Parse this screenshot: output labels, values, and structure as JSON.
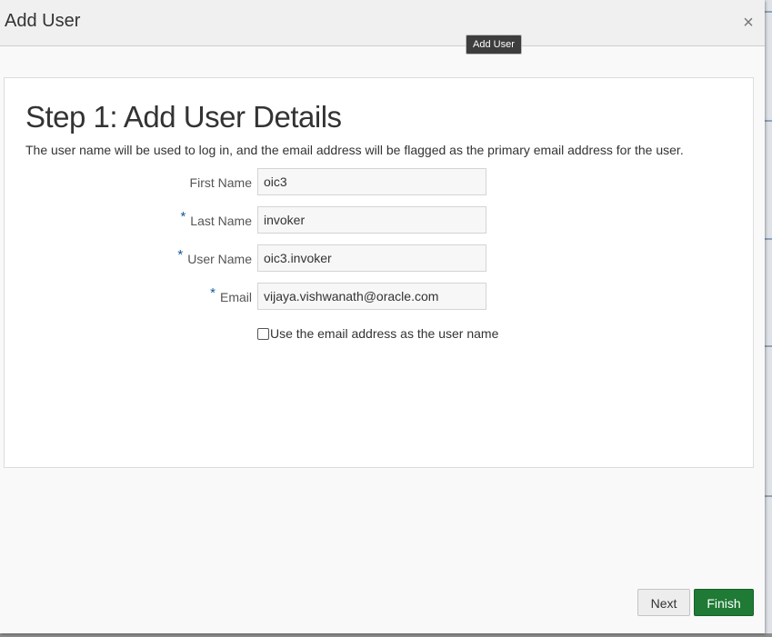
{
  "dialog": {
    "title": "Add User",
    "close_label": "×"
  },
  "tooltip": {
    "text": "Add User"
  },
  "step": {
    "title": "Step 1: Add User Details",
    "description": "The user name will be used to log in, and the email address will be flagged as the primary email address for the user."
  },
  "form": {
    "required_marker": "*",
    "fields": [
      {
        "label": "First Name",
        "value": "oic3",
        "required": false
      },
      {
        "label": "Last Name",
        "value": "invoker",
        "required": true
      },
      {
        "label": "User Name",
        "value": "oic3.invoker",
        "required": true
      },
      {
        "label": "Email",
        "value": "vijaya.vishwanath@oracle.com",
        "required": true
      }
    ],
    "use_email_checkbox": {
      "label": "Use the email address as the user name",
      "checked": false
    }
  },
  "buttons": {
    "next": "Next",
    "finish": "Finish"
  },
  "colors": {
    "required_marker": "#0f5a9e",
    "finish_button": "#1e7a34",
    "tooltip_bg": "#3d3d3d"
  }
}
